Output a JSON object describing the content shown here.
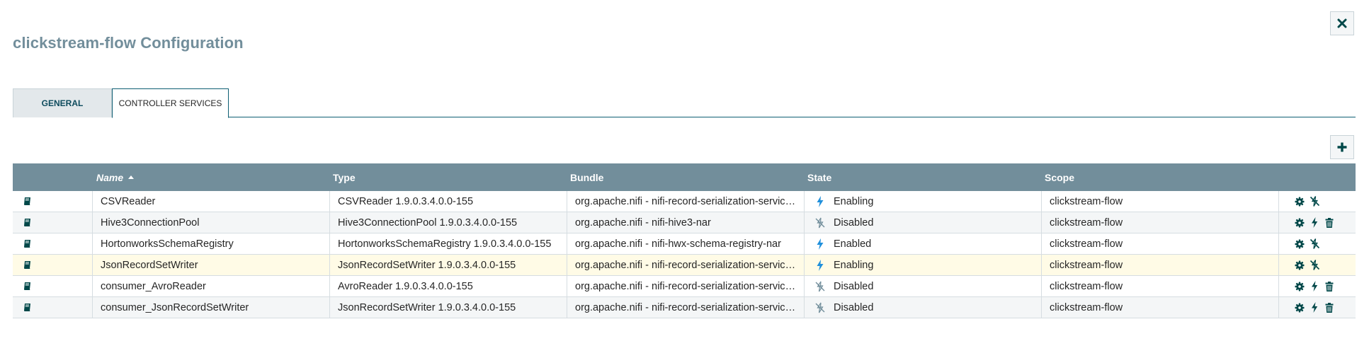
{
  "dialog": {
    "title": "clickstream-flow Configuration",
    "close_icon": "close-icon"
  },
  "tabs": [
    {
      "label": "GENERAL",
      "active": false
    },
    {
      "label": "CONTROLLER SERVICES",
      "active": true
    }
  ],
  "toolbar": {
    "add_icon": "plus-icon"
  },
  "table": {
    "columns": [
      "Name",
      "Type",
      "Bundle",
      "State",
      "Scope"
    ],
    "sort": {
      "column": "Name",
      "direction": "ascending"
    },
    "rows": [
      {
        "name": "CSVReader",
        "type": "CSVReader 1.9.0.3.4.0.0-155",
        "bundle": "org.apache.nifi - nifi-record-serialization-services-nar",
        "state": "Enabling",
        "scope": "clickstream-flow",
        "state_icon": "enabling-bolt-icon",
        "actions": [
          "configure-icon",
          "disable-icon"
        ]
      },
      {
        "name": "Hive3ConnectionPool",
        "type": "Hive3ConnectionPool 1.9.0.3.4.0.0-155",
        "bundle": "org.apache.nifi - nifi-hive3-nar",
        "state": "Disabled",
        "scope": "clickstream-flow",
        "state_icon": "disabled-icon",
        "actions": [
          "configure-icon",
          "enable-icon",
          "delete-icon"
        ]
      },
      {
        "name": "HortonworksSchemaRegistry",
        "type": "HortonworksSchemaRegistry 1.9.0.3.4.0.0-155",
        "bundle": "org.apache.nifi - nifi-hwx-schema-registry-nar",
        "state": "Enabled",
        "scope": "clickstream-flow",
        "state_icon": "enabled-bolt-icon",
        "actions": [
          "configure-icon",
          "disable-icon"
        ]
      },
      {
        "name": "JsonRecordSetWriter",
        "type": "JsonRecordSetWriter 1.9.0.3.4.0.0-155",
        "bundle": "org.apache.nifi - nifi-record-serialization-services-nar",
        "state": "Enabling",
        "scope": "clickstream-flow",
        "state_icon": "enabling-bolt-icon",
        "actions": [
          "configure-icon",
          "disable-icon"
        ]
      },
      {
        "name": "consumer_AvroReader",
        "type": "AvroReader 1.9.0.3.4.0.0-155",
        "bundle": "org.apache.nifi - nifi-record-serialization-services-nar",
        "state": "Disabled",
        "scope": "clickstream-flow",
        "state_icon": "disabled-icon",
        "actions": [
          "configure-icon",
          "enable-icon",
          "delete-icon"
        ]
      },
      {
        "name": "consumer_JsonRecordSetWriter",
        "type": "JsonRecordSetWriter 1.9.0.3.4.0.0-155",
        "bundle": "org.apache.nifi - nifi-record-serialization-services-nar",
        "state": "Disabled",
        "scope": "clickstream-flow",
        "state_icon": "disabled-icon",
        "actions": [
          "configure-icon",
          "enable-icon",
          "delete-icon"
        ]
      }
    ],
    "selected_row": 3
  },
  "colors": {
    "header_bg": "#728e9b",
    "accent": "#0e5e73",
    "bolt": "#1f8fdb",
    "icon_dark": "#004849",
    "selected_row": "#fffbe6"
  }
}
